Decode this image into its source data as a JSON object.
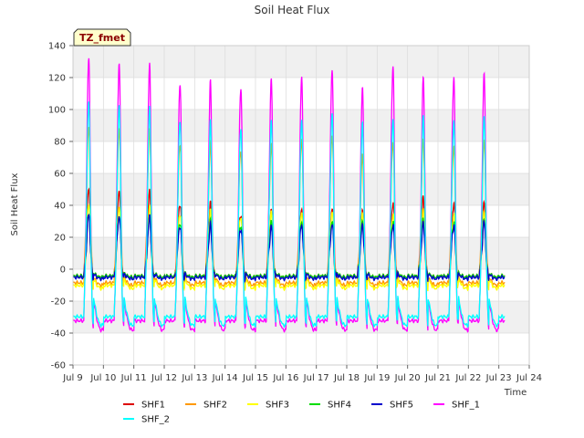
{
  "chart_data": {
    "type": "line",
    "title": "Soil Heat Flux",
    "xlabel": "Time",
    "ylabel": "Soil Heat Flux",
    "badge": "TZ_fmet",
    "xlim": [
      9,
      24
    ],
    "ylim": [
      -60,
      140
    ],
    "x_ticks": [
      {
        "v": 9,
        "label": "Jul 9"
      },
      {
        "v": 10,
        "label": "Jul 10"
      },
      {
        "v": 11,
        "label": "Jul 11"
      },
      {
        "v": 12,
        "label": "Jul 12"
      },
      {
        "v": 13,
        "label": "Jul 13"
      },
      {
        "v": 14,
        "label": "Jul 14"
      },
      {
        "v": 15,
        "label": "Jul 15"
      },
      {
        "v": 16,
        "label": "Jul 16"
      },
      {
        "v": 17,
        "label": "Jul 17"
      },
      {
        "v": 18,
        "label": "Jul 18"
      },
      {
        "v": 19,
        "label": "Jul 19"
      },
      {
        "v": 20,
        "label": "Jul 20"
      },
      {
        "v": 21,
        "label": "Jul 21"
      },
      {
        "v": 22,
        "label": "Jul 22"
      },
      {
        "v": 23,
        "label": "Jul 23"
      },
      {
        "v": 24,
        "label": "Jul 24"
      }
    ],
    "y_ticks": [
      -60,
      -40,
      -20,
      0,
      20,
      40,
      60,
      80,
      100,
      120,
      140
    ],
    "grid": true,
    "legend_position": "bottom",
    "series": [
      {
        "name": "SHF1",
        "color": "#dd0000",
        "start": 9.0,
        "end": 23.2,
        "night_min": -5,
        "peaks": [
          50,
          50,
          48,
          42,
          40,
          35,
          36,
          38,
          38,
          36,
          42,
          44,
          42,
          41,
          42
        ]
      },
      {
        "name": "SHF2",
        "color": "#ff9900",
        "start": 9.0,
        "end": 23.2,
        "night_min": -10,
        "peaks": [
          89,
          89,
          86,
          80,
          78,
          76,
          77,
          82,
          84,
          71,
          80,
          80,
          78,
          80,
          82
        ]
      },
      {
        "name": "SHF3",
        "color": "#ffff00",
        "start": 9.0,
        "end": 23.2,
        "night_min": -12,
        "peaks": [
          40,
          40,
          38,
          36,
          35,
          34,
          35,
          36,
          36,
          34,
          35,
          36,
          35,
          35,
          36
        ]
      },
      {
        "name": "SHF4",
        "color": "#00dd00",
        "start": 9.0,
        "end": 23.2,
        "night_min": -5,
        "peaks": [
          34,
          34,
          32,
          30,
          29,
          28,
          29,
          30,
          30,
          29,
          30,
          30,
          30,
          30,
          30
        ]
      },
      {
        "name": "SHF5",
        "color": "#0000cc",
        "start": 9.0,
        "end": 23.2,
        "night_min": -6,
        "peaks": [
          34,
          34,
          32,
          28,
          27,
          26,
          26,
          28,
          28,
          27,
          28,
          28,
          28,
          29,
          30
        ]
      },
      {
        "name": "SHF_1",
        "color": "#ff00ff",
        "start": 9.0,
        "end": 23.2,
        "night_min": -38,
        "peaks": [
          132,
          130,
          127,
          118,
          116,
          115,
          118,
          121,
          125,
          113,
          128,
          119,
          121,
          122,
          122
        ]
      },
      {
        "name": "SHF_2",
        "color": "#00ffff",
        "start": 9.0,
        "end": 23.2,
        "night_min": -35,
        "peaks": [
          105,
          104,
          100,
          95,
          91,
          90,
          92,
          94,
          98,
          91,
          95,
          95,
          94,
          95,
          96
        ]
      }
    ]
  }
}
